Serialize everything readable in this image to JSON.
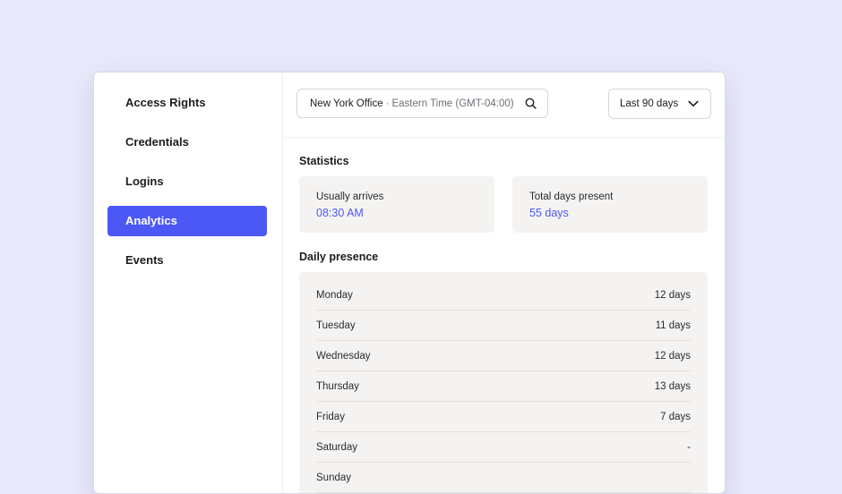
{
  "sidebar": {
    "items": [
      {
        "label": "Access Rights",
        "active": false
      },
      {
        "label": "Credentials",
        "active": false
      },
      {
        "label": "Logins",
        "active": false
      },
      {
        "label": "Analytics",
        "active": true
      },
      {
        "label": "Events",
        "active": false
      }
    ]
  },
  "toolbar": {
    "location": "New York Office",
    "separator": "·",
    "timezone": "Eastern Time (GMT-04:00)",
    "search_icon": "search-icon",
    "range_label": "Last 90 days",
    "range_icon": "chevron-down-icon"
  },
  "statistics": {
    "title": "Statistics",
    "cards": [
      {
        "label": "Usually arrives",
        "value": "08:30 AM"
      },
      {
        "label": "Total days present",
        "value": "55 days"
      }
    ]
  },
  "daily_presence": {
    "title": "Daily presence",
    "rows": [
      {
        "day": "Monday",
        "value": "12 days"
      },
      {
        "day": "Tuesday",
        "value": "11 days"
      },
      {
        "day": "Wednesday",
        "value": "12 days"
      },
      {
        "day": "Thursday",
        "value": "13 days"
      },
      {
        "day": "Friday",
        "value": "7 days"
      },
      {
        "day": "Saturday",
        "value": "-"
      },
      {
        "day": "Sunday",
        "value": ""
      }
    ]
  },
  "colors": {
    "accent": "#4c58f6",
    "background": "#e9e9fb",
    "card": "#f4f3f2"
  }
}
